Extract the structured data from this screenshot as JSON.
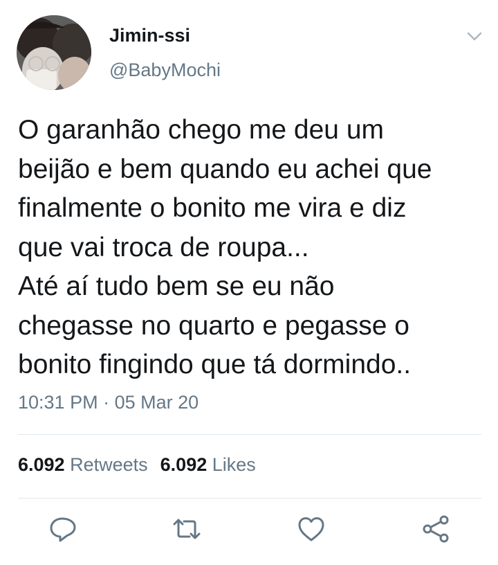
{
  "user": {
    "display_name": "Jimin-ssi",
    "handle": "@BabyMochi"
  },
  "tweet": {
    "lines": [
      "O garanhão chego me deu um",
      "beijão e bem quando eu achei que",
      "finalmente o bonito me vira e diz",
      "que vai troca de roupa...",
      "Até aí tudo bem se eu não",
      "chegasse no quarto e pegasse o",
      "bonito fingindo que tá dormindo.."
    ],
    "time": "10:31 PM",
    "separator": "·",
    "date": "05 Mar 20"
  },
  "stats": {
    "retweets_count": "6.092",
    "retweets_label": "Retweets",
    "likes_count": "6.092",
    "likes_label": "Likes"
  },
  "icons": {
    "menu": "chevron-down-icon",
    "reply": "reply-icon",
    "retweet": "retweet-icon",
    "like": "heart-icon",
    "share": "share-icon"
  },
  "colors": {
    "text_primary": "#14171a",
    "text_secondary": "#657786",
    "divider": "#e1e8ed"
  }
}
